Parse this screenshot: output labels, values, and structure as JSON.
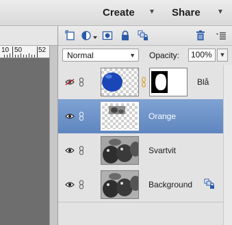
{
  "topbar": {
    "create_label": "Create",
    "share_label": "Share"
  },
  "ruler": {
    "labels": [
      "10",
      "50",
      "52"
    ]
  },
  "layers_panel": {
    "toolbar_icons": [
      "new-layer-icon",
      "adjustment-layer-icon",
      "add-mask-icon",
      "lock-icon",
      "lock-all-icon",
      "trash-icon",
      "panel-menu-icon"
    ],
    "blend_mode": "Normal",
    "opacity_label": "Opacity:",
    "opacity_value": "100%",
    "layers": [
      {
        "name": "Blå",
        "visible": false,
        "has_mask": true,
        "selected": false
      },
      {
        "name": "Orange",
        "visible": true,
        "has_mask": false,
        "selected": true
      },
      {
        "name": "Svartvit",
        "visible": true,
        "has_mask": false,
        "selected": false
      },
      {
        "name": "Background",
        "visible": true,
        "has_mask": false,
        "selected": false,
        "locked": true
      }
    ]
  },
  "colors": {
    "selection": "#6a8fc8",
    "canvas": "#6b6b6b",
    "panel": "#e3e3e3",
    "blue_layer": "#1b46b8",
    "link_accent": "#d9a03a"
  }
}
